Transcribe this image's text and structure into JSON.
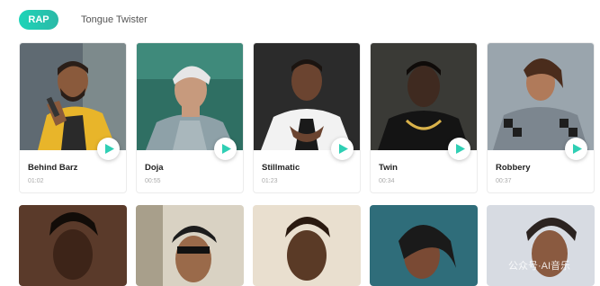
{
  "tabs": {
    "active": "RAP",
    "other": "Tongue Twister"
  },
  "colors": {
    "accent": "#1ed4b8",
    "play_icon": "#2fcfb4"
  },
  "cards": [
    {
      "title": "Behind Barz",
      "duration": "01:02"
    },
    {
      "title": "Doja",
      "duration": "00:55"
    },
    {
      "title": "Stillmatic",
      "duration": "01:23"
    },
    {
      "title": "Twin",
      "duration": "00:34"
    },
    {
      "title": "Robbery",
      "duration": "00:37"
    }
  ],
  "second_row": [
    {
      "name": "thumbnail-6"
    },
    {
      "name": "thumbnail-7"
    },
    {
      "name": "thumbnail-8"
    },
    {
      "name": "thumbnail-9"
    },
    {
      "name": "thumbnail-10"
    }
  ],
  "watermark": "公众号·AI音乐"
}
